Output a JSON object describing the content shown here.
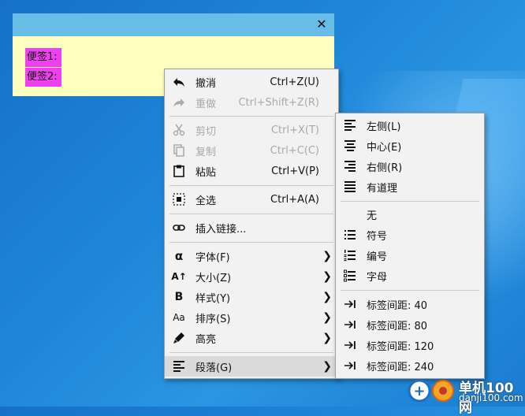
{
  "note": {
    "close": "✕",
    "lines": [
      "便签1:",
      "便签2:"
    ]
  },
  "menu": {
    "items": [
      {
        "label": "撤消",
        "shortcut": "Ctrl+Z(U)",
        "icon": "undo-icon"
      },
      {
        "label": "重做",
        "shortcut": "Ctrl+Shift+Z(R)",
        "icon": "redo-icon"
      },
      {
        "label": "剪切",
        "shortcut": "Ctrl+X(T)",
        "icon": "scissors-icon"
      },
      {
        "label": "复制",
        "shortcut": "Ctrl+C(C)",
        "icon": "copy-icon"
      },
      {
        "label": "粘贴",
        "shortcut": "Ctrl+V(P)",
        "icon": "clipboard-icon"
      },
      {
        "label": "全选",
        "shortcut": "Ctrl+A(A)",
        "icon": "select-all-icon"
      },
      {
        "label": "插入链接...",
        "icon": "link-icon"
      },
      {
        "label": "字体(F)",
        "icon": "alpha-icon"
      },
      {
        "label": "大小(Z)",
        "icon": "font-size-icon"
      },
      {
        "label": "样式(Y)",
        "icon": "bold-icon"
      },
      {
        "label": "排序(S)",
        "icon": "case-icon"
      },
      {
        "label": "高亮",
        "icon": "highlighter-icon"
      },
      {
        "label": "段落(G)",
        "icon": "paragraph-icon"
      }
    ],
    "arrow": "❯"
  },
  "submenu": {
    "items": [
      {
        "label": "左侧(L)",
        "icon": "align-left-icon"
      },
      {
        "label": "中心(E)",
        "icon": "align-center-icon"
      },
      {
        "label": "右侧(R)",
        "icon": "align-right-icon"
      },
      {
        "label": "有道理",
        "icon": "align-justify-icon"
      },
      {
        "label": "无",
        "icon": ""
      },
      {
        "label": "符号",
        "icon": "bullet-list-icon"
      },
      {
        "label": "编号",
        "icon": "numbered-list-icon"
      },
      {
        "label": "字母",
        "icon": "letter-list-icon"
      },
      {
        "label": "标签间距: 40",
        "icon": "tab-stop-icon"
      },
      {
        "label": "标签间距: 80",
        "icon": "tab-stop-icon"
      },
      {
        "label": "标签间距: 120",
        "icon": "tab-stop-icon"
      },
      {
        "label": "标签间距: 240",
        "icon": "tab-stop-icon"
      }
    ]
  },
  "watermark": {
    "name": "单机100网",
    "url": "danji100.com"
  }
}
